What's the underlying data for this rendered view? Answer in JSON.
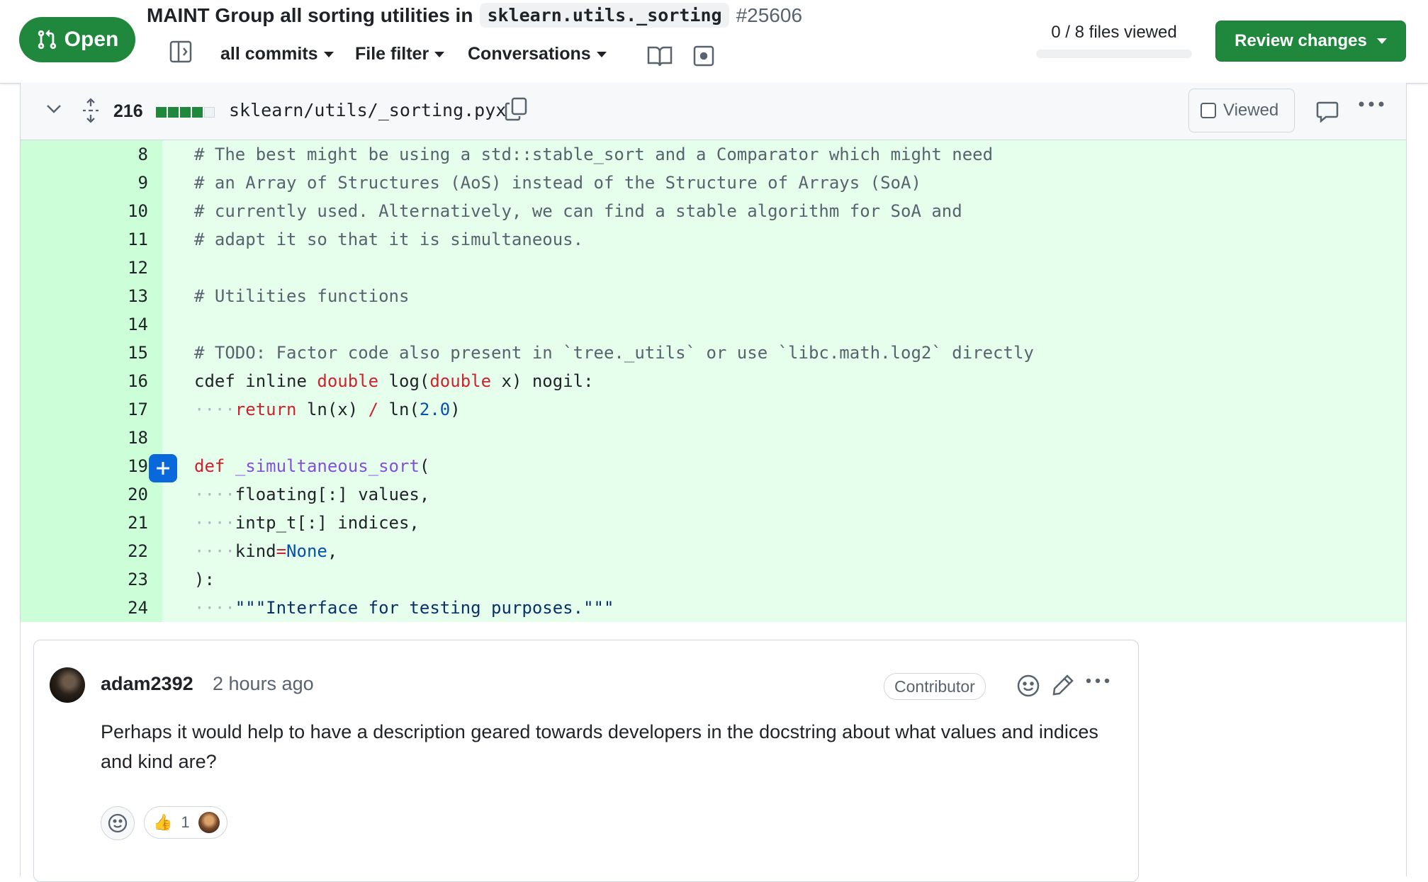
{
  "pr": {
    "state": "Open",
    "title_prefix": "MAINT Group all sorting utilities in",
    "title_code": "sklearn.utils._sorting",
    "number": "#25606"
  },
  "toolbar": {
    "commits_label": "all commits",
    "file_filter_label": "File filter",
    "conversations_label": "Conversations",
    "files_viewed": "0 / 8 files viewed",
    "files_viewed_progress": 0,
    "review_button": "Review changes"
  },
  "file": {
    "diffstat_count": "216",
    "diffstat_added_blocks": 4,
    "diffstat_neutral_blocks": 1,
    "path": "sklearn/utils/_sorting.pyx",
    "viewed_label": "Viewed",
    "viewed": false
  },
  "code_lines": [
    {
      "n": "8",
      "tokens": [
        [
          "c",
          "# The best might be using a std::stable_sort and a Comparator which might need"
        ]
      ]
    },
    {
      "n": "9",
      "tokens": [
        [
          "c",
          "# an Array of Structures (AoS) instead of the Structure of Arrays (SoA)"
        ]
      ]
    },
    {
      "n": "10",
      "tokens": [
        [
          "c",
          "# currently used. Alternatively, we can find a stable algorithm for SoA and"
        ]
      ]
    },
    {
      "n": "11",
      "tokens": [
        [
          "c",
          "# adapt it so that it is simultaneous."
        ]
      ]
    },
    {
      "n": "12",
      "tokens": []
    },
    {
      "n": "13",
      "tokens": [
        [
          "c",
          "# Utilities functions"
        ]
      ]
    },
    {
      "n": "14",
      "tokens": []
    },
    {
      "n": "15",
      "tokens": [
        [
          "c",
          "# TODO: Factor code also present in `tree._utils` or use `libc.math.log2` directly"
        ]
      ]
    },
    {
      "n": "16",
      "tokens": [
        [
          "p",
          "cdef inline "
        ],
        [
          "k",
          "double"
        ],
        [
          "p",
          " log("
        ],
        [
          "k",
          "double"
        ],
        [
          "p",
          " x) nogil:"
        ]
      ]
    },
    {
      "n": "17",
      "tokens": [
        [
          "w",
          "    "
        ],
        [
          "k",
          "return"
        ],
        [
          "p",
          " ln(x) "
        ],
        [
          "k",
          "/"
        ],
        [
          "p",
          " ln("
        ],
        [
          "n",
          "2.0"
        ],
        [
          "p",
          ")"
        ]
      ]
    },
    {
      "n": "18",
      "tokens": []
    },
    {
      "n": "19",
      "tokens": [
        [
          "k",
          "def"
        ],
        [
          "p",
          " "
        ],
        [
          "f",
          "_simultaneous_sort"
        ],
        [
          "p",
          "("
        ]
      ]
    },
    {
      "n": "20",
      "tokens": [
        [
          "w",
          "    "
        ],
        [
          "p",
          "floating[:] values,"
        ]
      ]
    },
    {
      "n": "21",
      "tokens": [
        [
          "w",
          "    "
        ],
        [
          "p",
          "intp_t[:] indices,"
        ]
      ]
    },
    {
      "n": "22",
      "tokens": [
        [
          "w",
          "    "
        ],
        [
          "p",
          "kind"
        ],
        [
          "k",
          "="
        ],
        [
          "n",
          "None"
        ],
        [
          "p",
          ","
        ]
      ]
    },
    {
      "n": "23",
      "tokens": [
        [
          "p",
          "):"
        ]
      ]
    },
    {
      "n": "24",
      "tokens": [
        [
          "w",
          "    "
        ],
        [
          "s",
          "\"\"\"Interface for testing purposes.\"\"\""
        ]
      ]
    }
  ],
  "comment": {
    "author": "adam2392",
    "time": "2 hours ago",
    "role": "Contributor",
    "body": "Perhaps it would help to have a description geared towards developers in the docstring about what values and indices and kind are?",
    "reaction_emoji": "👍",
    "reaction_count": "1"
  },
  "colors": {
    "open_green": "#1f883d",
    "added_line_bg": "#e6ffec",
    "added_gutter_bg": "#ccffd8",
    "add_comment_blue": "#0969da"
  },
  "icons": [
    "git-pull-request-icon",
    "sidebar-toggle-icon",
    "book-icon",
    "dot-square-icon",
    "chevron-down-icon",
    "unfold-icon",
    "copy-icon",
    "comment-icon",
    "kebab-horizontal-icon",
    "plus-icon",
    "smiley-icon",
    "pencil-icon"
  ]
}
